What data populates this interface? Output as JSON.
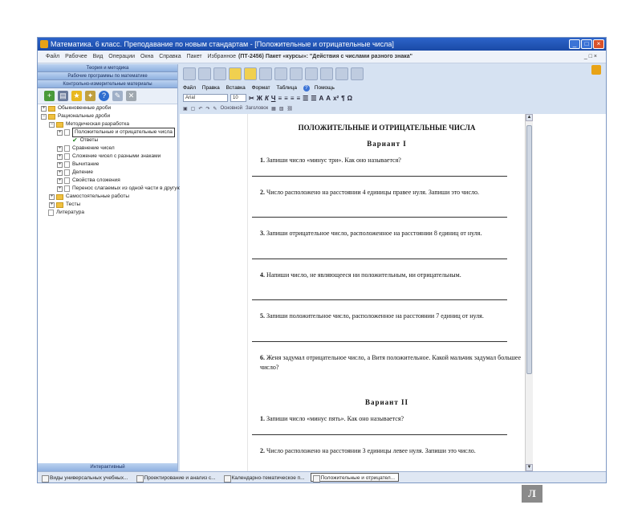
{
  "window": {
    "title": "Математика. 6 класс. Преподавание по новым стандартам - [Положительные и отрицательные числа]",
    "buttons": [
      "_",
      "□",
      "×"
    ]
  },
  "menubar": {
    "items": [
      "Файл",
      "Рабочее",
      "Вид",
      "Операции",
      "Окна",
      "Справка"
    ],
    "extra": [
      "Пакет",
      "Избранное"
    ],
    "doc_banner": "(ПТ-2456) Пакет «курсы»: \"Действия с числами разного знака\"",
    "right": "_ □ ×"
  },
  "left_panel": {
    "tabs": [
      "Теория и методика",
      "Рабочие программы по математике",
      "Контрольно-измерительные материалы"
    ],
    "footer": "Интерактивный",
    "tree": [
      {
        "text": "Обыкновенные дроби",
        "level": 0,
        "type": "folder",
        "expander": "+"
      },
      {
        "text": "Рациональные дроби",
        "level": 0,
        "type": "folder",
        "expander": "−"
      },
      {
        "text": "Методическая разработка",
        "level": 1,
        "type": "folder",
        "expander": "−"
      },
      {
        "text": "Положительные и отрицательные числа",
        "level": 2,
        "type": "page",
        "expander": "+",
        "selected": true
      },
      {
        "text": "Ответы",
        "level": 3,
        "type": "check",
        "expander": ""
      },
      {
        "text": "Сравнение чисел",
        "level": 2,
        "type": "page",
        "expander": "+"
      },
      {
        "text": "Сложение чисел с разными знаками",
        "level": 2,
        "type": "page",
        "expander": "+"
      },
      {
        "text": "Вычитание",
        "level": 2,
        "type": "page",
        "expander": "+"
      },
      {
        "text": "Деление",
        "level": 2,
        "type": "page",
        "expander": "+"
      },
      {
        "text": "Свойства сложения",
        "level": 2,
        "type": "page",
        "expander": "+"
      },
      {
        "text": "Перенос слагаемых из одной части в другую",
        "level": 2,
        "type": "page",
        "expander": "+"
      },
      {
        "text": "Самостоятельные работы",
        "level": 1,
        "type": "folder",
        "expander": "+"
      },
      {
        "text": "Тесты",
        "level": 1,
        "type": "folder",
        "expander": "+"
      },
      {
        "text": "Литература",
        "level": 0,
        "type": "page",
        "expander": ""
      }
    ]
  },
  "editor": {
    "menu": [
      "Файл",
      "Правка",
      "Вставка",
      "Формат",
      "Таблица"
    ],
    "help": "Помощь",
    "font": "Arial",
    "size": "10",
    "style_label": "Основной",
    "preview_label": "Заголовок"
  },
  "document": {
    "heading": "ПОЛОЖИТЕЛЬНЫЕ И ОТРИЦАТЕЛЬНЫЕ ЧИСЛА",
    "variant1": "Вариант I",
    "variant2": "Вариант II",
    "questions": [
      {
        "num": "1.",
        "text": "Запиши число «минус три». Как оно называется?"
      },
      {
        "num": "2.",
        "text": "Число расположено на расстоянии 4 единицы правее нуля. Запиши это число."
      },
      {
        "num": "3.",
        "text": "Запиши отрицательное число, расположенное на расстоянии 8 единиц от нуля."
      },
      {
        "num": "4.",
        "text": "Напиши число, не являющееся ни положительным, ни отрицательным."
      },
      {
        "num": "5.",
        "text": "Запиши положительное число, расположенное на расстоянии 7 единиц от нуля."
      },
      {
        "num": "6.",
        "text": "Женя задумал отрицательное число, а Витя положительное. Какой мальчик задумал большее число?"
      },
      {
        "num": "1.",
        "text": "Запиши число «минус пять». Как оно называется?"
      },
      {
        "num": "2.",
        "text": "Число расположено на расстоянии 3 единицы левее нуля. Запиши это число."
      }
    ]
  },
  "taskbar": {
    "items": [
      "Виды универсальных учебных...",
      "Проектирование и анализ с...",
      "Календарно-тематическое п...",
      "Положительные и отрицател..."
    ]
  },
  "logo": "Л"
}
